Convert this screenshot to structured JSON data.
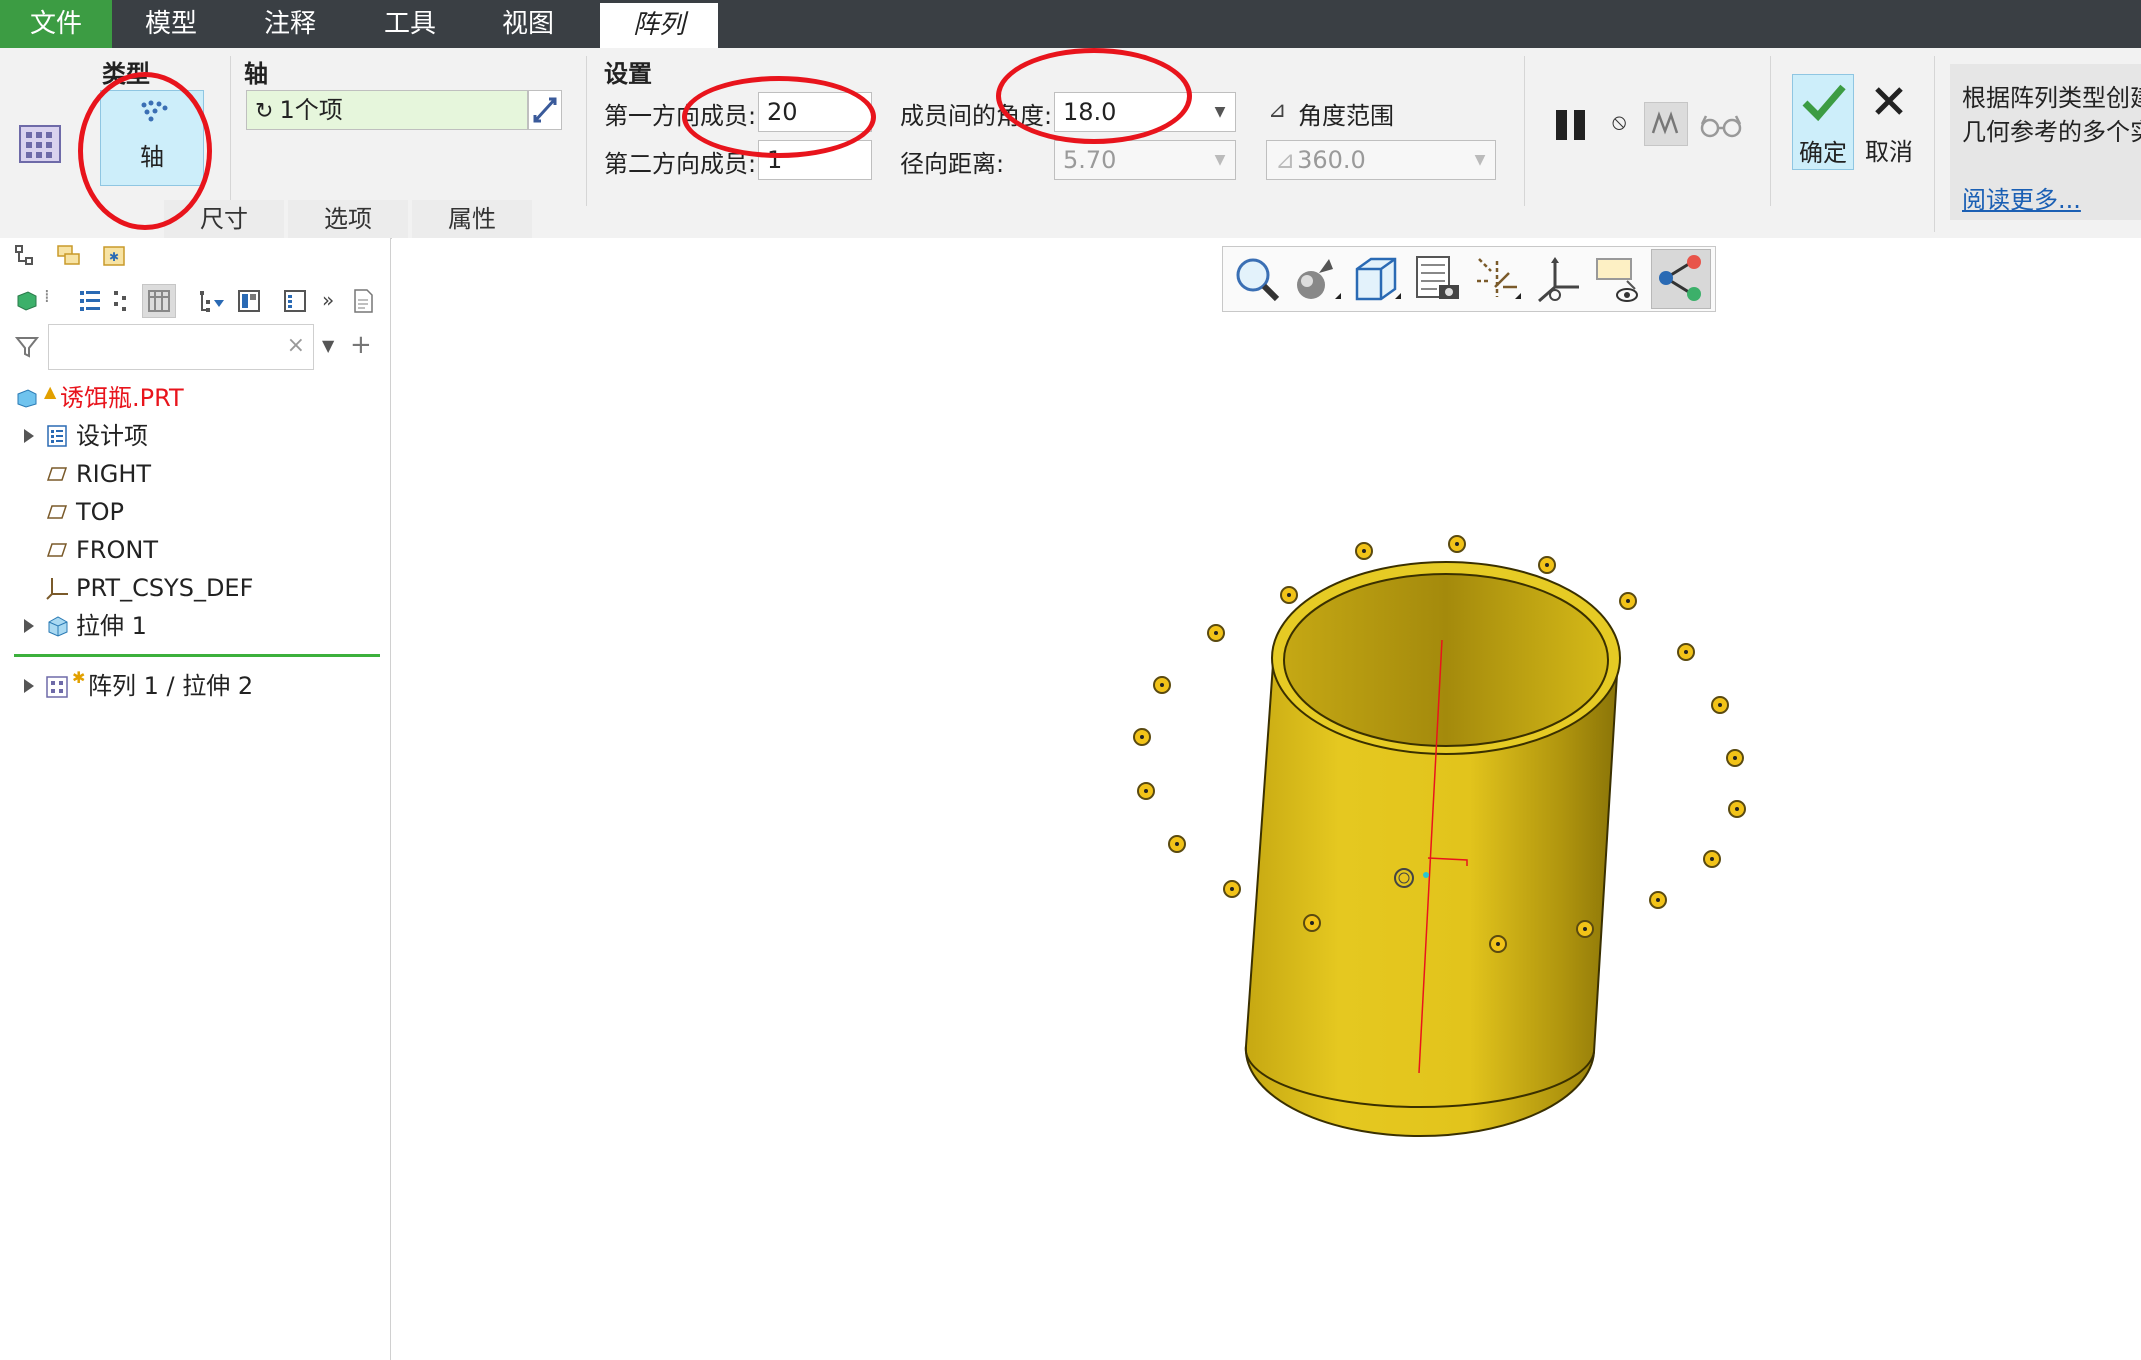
{
  "menu": {
    "tabs": [
      {
        "label": "文件"
      },
      {
        "label": "模型"
      },
      {
        "label": "注释"
      },
      {
        "label": "工具"
      },
      {
        "label": "视图"
      },
      {
        "label": "阵列"
      }
    ]
  },
  "ribbon": {
    "type_group_label": "类型",
    "type_button_label": "轴",
    "axis_group_label": "轴",
    "axis_reference_value": "1个项",
    "settings_group_label": "设置",
    "first_dir_label": "第一方向成员:",
    "first_dir_value": "20",
    "second_dir_label": "第二方向成员:",
    "second_dir_value": "1",
    "angle_between_label": "成员间的角度:",
    "angle_between_value": "18.0",
    "radial_distance_label": "径向距离:",
    "radial_distance_value": "5.70",
    "angle_range_label": "角度范围",
    "angle_range_value": "360.0",
    "ok_label": "确定",
    "cancel_label": "取消",
    "help_line1": "根据阵列类型创建",
    "help_line2": "几何参考的多个实",
    "read_more": "阅读更多...",
    "subtabs": [
      {
        "label": "尺寸"
      },
      {
        "label": "选项"
      },
      {
        "label": "属性"
      }
    ]
  },
  "model_tree": {
    "root": "诱饵瓶.PRT",
    "items": [
      {
        "label": "设计项"
      },
      {
        "label": "RIGHT"
      },
      {
        "label": "TOP"
      },
      {
        "label": "FRONT"
      },
      {
        "label": "PRT_CSYS_DEF"
      },
      {
        "label": "拉伸 1"
      }
    ],
    "pattern_item": "阵列 1 / 拉伸 2"
  },
  "colors": {
    "file_tab": "#3c9c43",
    "menubar": "#3a3f44",
    "model_yellow": "#e2c41c",
    "annotation_red": "#e8141c",
    "ok_green": "#3c9c43",
    "link_blue": "#1a5fb4"
  }
}
